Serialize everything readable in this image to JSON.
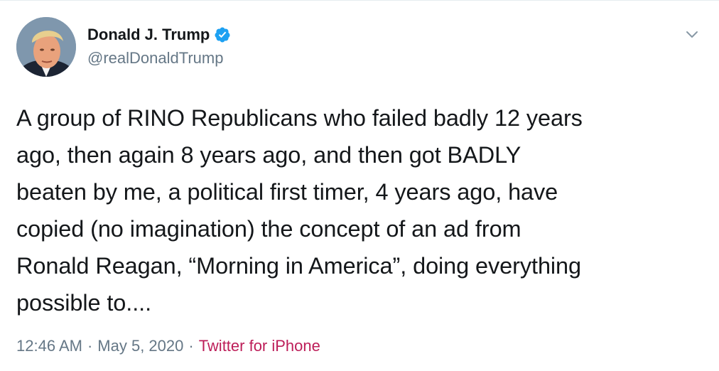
{
  "tweet": {
    "author": {
      "display_name": "Donald J. Trump",
      "handle": "@realDonaldTrump",
      "verified": true,
      "verified_icon": "verified-badge-icon",
      "verified_color": "#1da1f2"
    },
    "menu_icon": "chevron-down-icon",
    "text": "A group of RINO Republicans who failed badly 12 years\nago, then again 8 years ago, and then got BADLY\nbeaten by me, a political first timer, 4 years ago, have\ncopied (no imagination) the concept of an ad from\nRonald Reagan, “Morning in America”, doing everything\npossible to....",
    "time": "12:46 AM",
    "separator": "·",
    "date": "May 5, 2020",
    "source": "Twitter for iPhone",
    "source_color": "#bd1e59",
    "meta_color": "#657786"
  }
}
